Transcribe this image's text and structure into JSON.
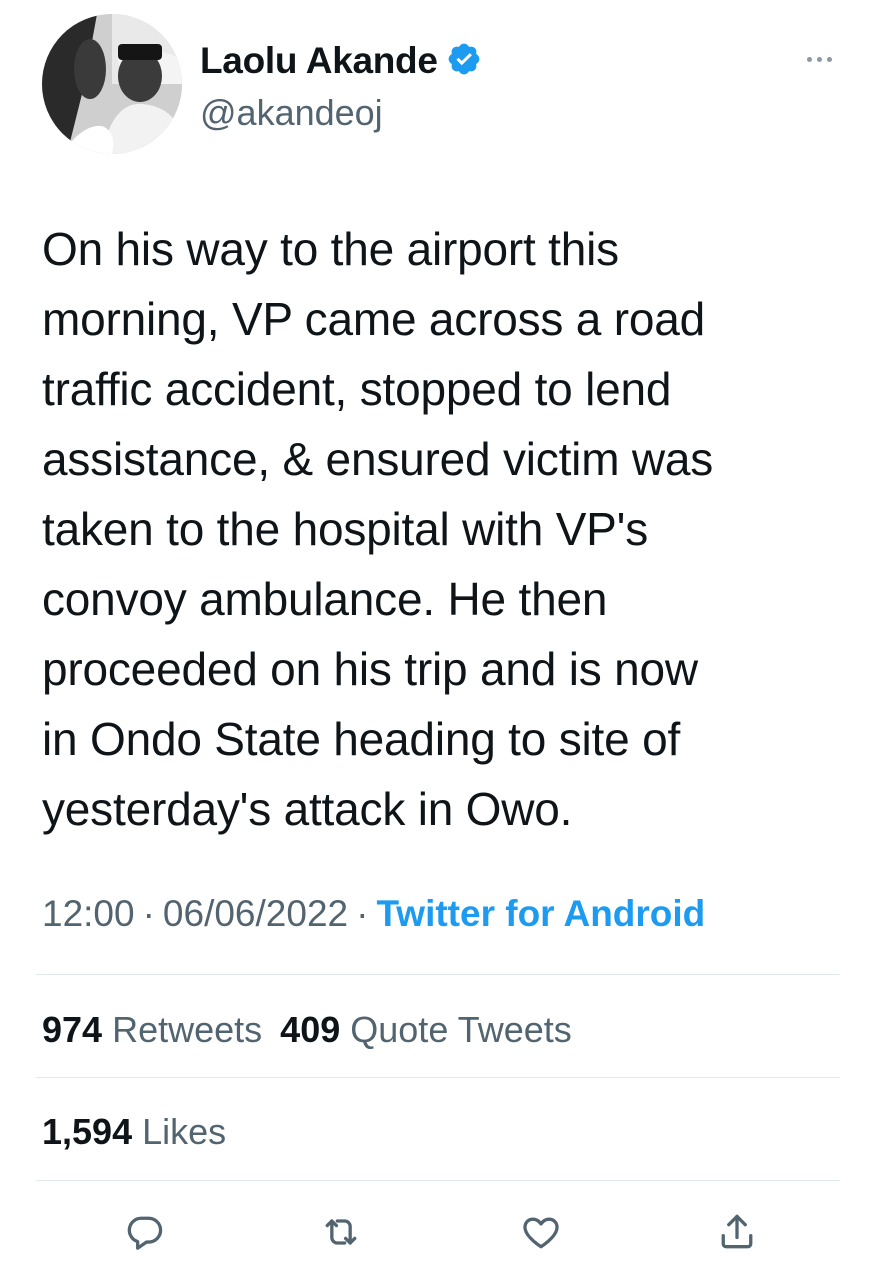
{
  "user": {
    "display_name": "Laolu Akande",
    "handle": "@akandeoj",
    "verified": true
  },
  "tweet": {
    "text": "On his way to the airport this\nmorning, VP came across a road\ntraffic accident, stopped to lend\nassistance, & ensured victim was\ntaken to the hospital with VP's\nconvoy ambulance. He then\nproceeded on his trip and is now\nin Ondo State heading to site of\nyesterday's attack in Owo.",
    "time": "12:00",
    "date": "06/06/2022",
    "source": "Twitter for Android",
    "separator": "·"
  },
  "stats": {
    "retweets_count": "974",
    "retweets_label": "Retweets",
    "quotes_count": "409",
    "quotes_label": "Quote Tweets",
    "likes_count": "1,594",
    "likes_label": "Likes"
  },
  "actions": [
    "reply-icon",
    "retweet-icon",
    "like-icon",
    "share-icon"
  ],
  "colors": {
    "accent": "#1d9bf0",
    "secondary_text": "#536471",
    "primary_text": "#0f1419",
    "divider": "#e1e8ed"
  }
}
